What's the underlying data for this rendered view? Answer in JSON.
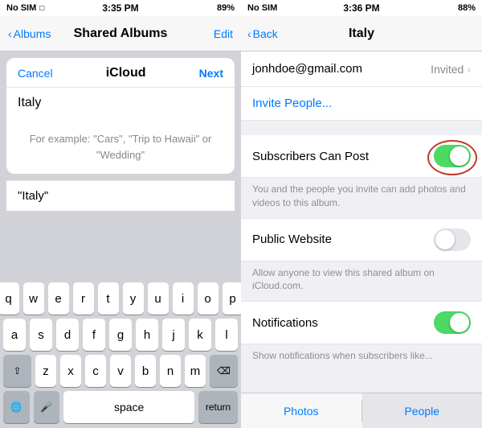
{
  "left": {
    "statusBar": {
      "carrier": "No SIM",
      "time": "3:35 PM",
      "battery": "89%"
    },
    "albumsNav": {
      "backLabel": "Albums",
      "title": "Shared Albums",
      "editLabel": "Edit"
    },
    "dialog": {
      "cancelLabel": "Cancel",
      "title": "iCloud",
      "nextLabel": "Next",
      "inputValue": "Italy",
      "hintText": "For example: \"Cars\", \"Trip to Hawaii\" or \"Wedding\"",
      "suggestionLabel": "\"Italy\""
    },
    "keyboard": {
      "row1": [
        "q",
        "w",
        "e",
        "r",
        "t",
        "y",
        "u",
        "i",
        "o",
        "p"
      ],
      "row2": [
        "a",
        "s",
        "d",
        "f",
        "g",
        "h",
        "j",
        "k",
        "l"
      ],
      "row3": [
        "z",
        "x",
        "c",
        "v",
        "b",
        "n",
        "m"
      ],
      "spaceLabel": "space",
      "returnLabel": "return"
    }
  },
  "right": {
    "statusBar": {
      "carrier": "No SIM",
      "time": "3:36 PM",
      "battery": "88%"
    },
    "nav": {
      "backLabel": "Back",
      "title": "Italy"
    },
    "settings": {
      "emailItem": {
        "email": "jonhdoe@gmail.com",
        "status": "Invited"
      },
      "inviteLabel": "Invite People...",
      "subscribersCanPost": {
        "label": "Subscribers Can Post",
        "enabled": true,
        "description": "You and the people you invite can add photos and videos to this album."
      },
      "publicWebsite": {
        "label": "Public Website",
        "enabled": false,
        "description": "Allow anyone to view this shared album on iCloud.com."
      },
      "notifications": {
        "label": "Notifications",
        "enabled": true,
        "description": "Show notifications when subscribers like..."
      }
    },
    "tabs": {
      "photosLabel": "Photos",
      "peopleLabel": "People"
    }
  }
}
